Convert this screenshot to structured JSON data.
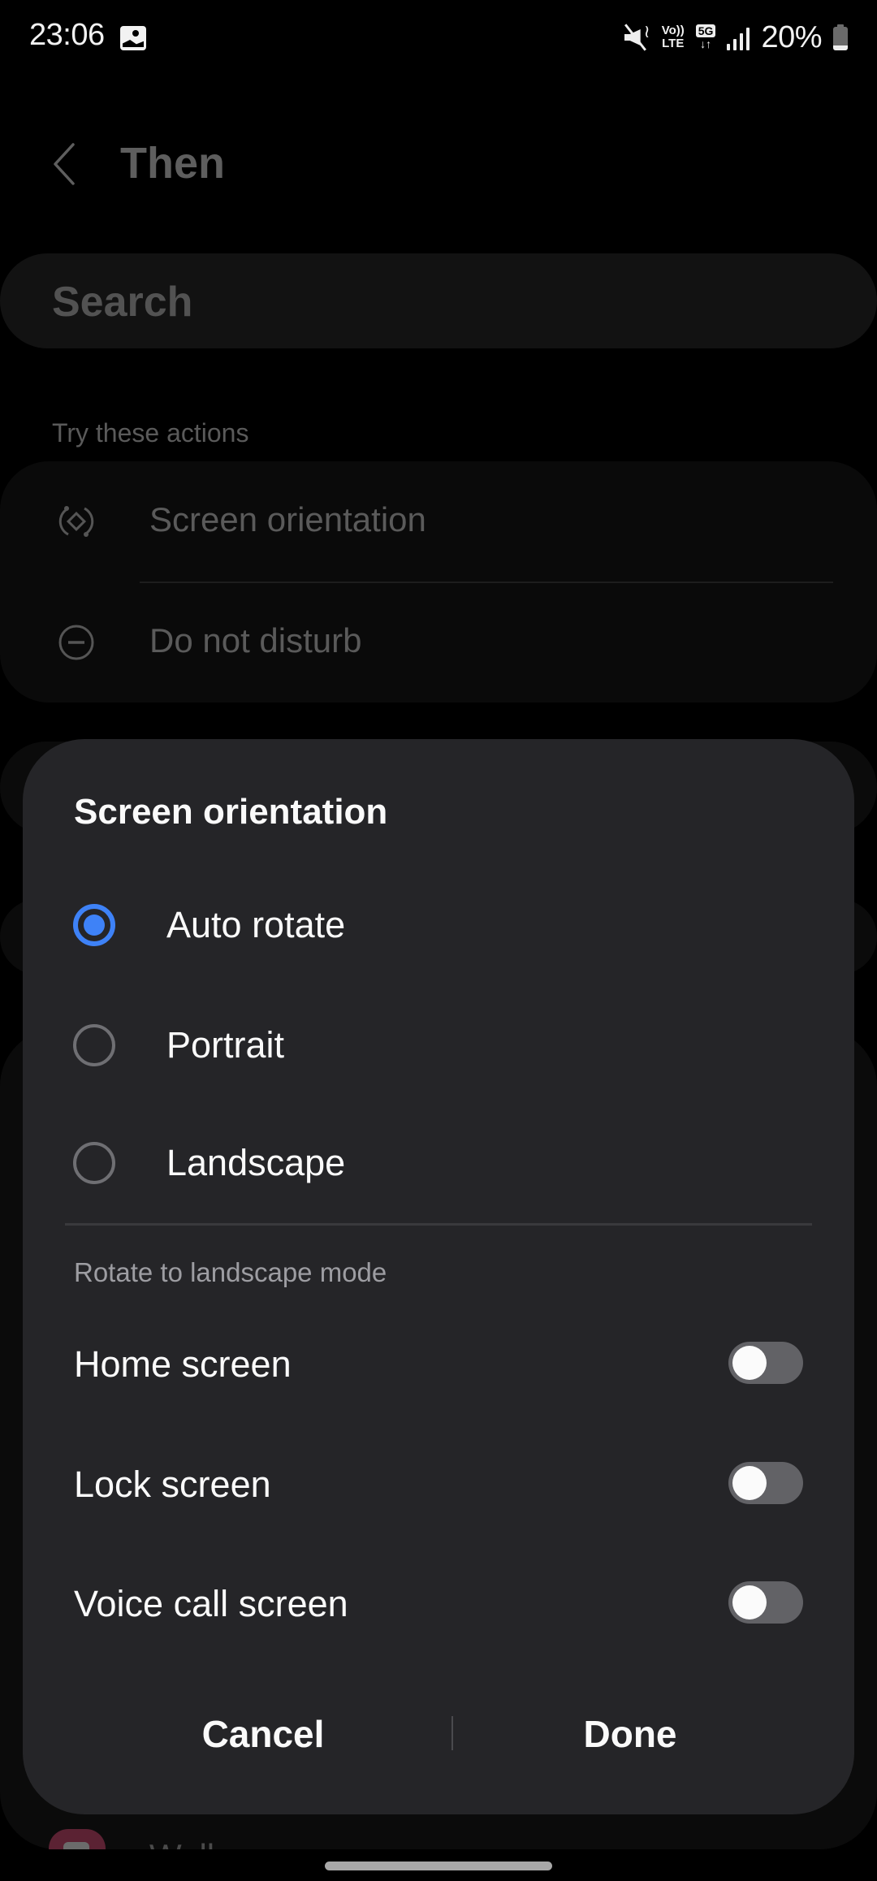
{
  "status_bar": {
    "time": "23:06",
    "notification_icons": [
      "gallery-icon"
    ],
    "system_icons": [
      "mute-icon",
      "volte-lte-icon",
      "5g-data-icon",
      "signal-icon",
      "battery-icon"
    ],
    "volte_top": "Vo))",
    "volte_bottom": "LTE",
    "network": "5G",
    "network_arrows": "↓↑",
    "battery_percent": "20%",
    "battery_level": 0.2
  },
  "background": {
    "title": "Then",
    "search_placeholder": "Search",
    "section_label": "Try these actions",
    "actions": [
      {
        "icon": "screen-rotation-icon",
        "label": "Screen orientation"
      },
      {
        "icon": "do-not-disturb-icon",
        "label": "Do not disturb"
      }
    ],
    "partial_item_label": "Wall"
  },
  "dialog": {
    "title": "Screen orientation",
    "options": [
      {
        "label": "Auto rotate",
        "selected": true
      },
      {
        "label": "Portrait",
        "selected": false
      },
      {
        "label": "Landscape",
        "selected": false
      }
    ],
    "subheading": "Rotate to landscape mode",
    "toggles": [
      {
        "label": "Home screen",
        "on": false
      },
      {
        "label": "Lock screen",
        "on": false
      },
      {
        "label": "Voice call screen",
        "on": false
      }
    ],
    "cancel_label": "Cancel",
    "done_label": "Done"
  },
  "colors": {
    "accent": "#3e82f7",
    "dialog_bg": "#252528",
    "toggle_off_track": "#626266"
  }
}
